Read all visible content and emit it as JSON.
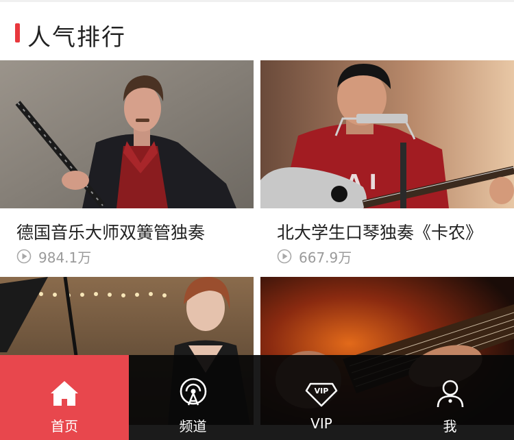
{
  "section": {
    "title": "人气排行"
  },
  "videos": [
    {
      "title": "德国音乐大师双簧管独奏",
      "plays": "984.1万"
    },
    {
      "title": "北大学生口琴独奏《卡农》",
      "plays": "667.9万"
    },
    {
      "title": "",
      "plays": ""
    },
    {
      "title": "",
      "plays": ""
    }
  ],
  "tabbar": {
    "items": [
      {
        "label": "首页",
        "icon": "home-icon",
        "active": true
      },
      {
        "label": "频道",
        "icon": "broadcast-icon",
        "active": false
      },
      {
        "label": "VIP",
        "icon": "vip-diamond-icon",
        "active": false
      },
      {
        "label": "我",
        "icon": "user-icon",
        "active": false
      }
    ]
  },
  "colors": {
    "accent": "#e8474d",
    "tabbar_bg": "#080808",
    "meta_text": "#9a9a9a"
  }
}
